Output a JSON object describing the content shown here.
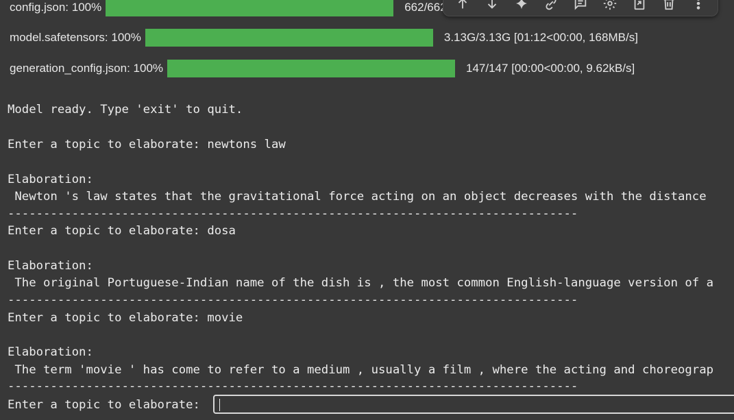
{
  "downloads": [
    {
      "name": "config.json:",
      "percent": "100%",
      "progress": 1.0,
      "stats": "662/662"
    },
    {
      "name": "model.safetensors:",
      "percent": "100%",
      "progress": 1.0,
      "stats": "3.13G/3.13G  [01:12<00:00,  168MB/s]"
    },
    {
      "name": "generation_config.json:",
      "percent": "100%",
      "progress": 1.0,
      "stats": "147/147  [00:00<00:00,  9.62kB/s]"
    }
  ],
  "bar_color": "#4caf50",
  "toolbar": {
    "icons": [
      "arrow-up-icon",
      "arrow-down-icon",
      "sparkle-icon",
      "link-icon",
      "comment-icon",
      "gear-icon",
      "mirror-cell-icon",
      "trash-icon",
      "more-vert-icon"
    ]
  },
  "terminal": {
    "ready": "Model ready. Type 'exit' to quit.",
    "prompt1": "Enter a topic to elaborate: newtons law",
    "elab_label1": "Elaboration:",
    "elab_text1": " Newton 's law states that the gravitational force acting on an object decreases with the distance",
    "separator": "--------------------------------------------------------------------------------",
    "prompt2": "Enter a topic to elaborate: dosa",
    "elab_label2": "Elaboration:",
    "elab_text2": " The original Portuguese-Indian name of the dish is , the most common English-language version of a",
    "prompt3": "Enter a topic to elaborate: movie",
    "elab_label3": "Elaboration:",
    "elab_text3": " The term 'movie ' has come to refer to a medium , usually a film , where the acting and choreograp",
    "prompt_current": "Enter a topic to elaborate: ",
    "input_value": ""
  }
}
